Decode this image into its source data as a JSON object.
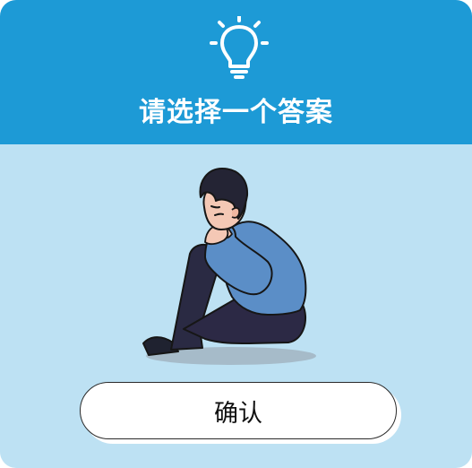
{
  "header": {
    "icon": "lightbulb-icon",
    "title": "请选择一个答案"
  },
  "illustration": {
    "name": "sad-person-sitting-illustration"
  },
  "actions": {
    "confirm_label": "确认"
  },
  "colors": {
    "header_bg": "#1d9ad6",
    "body_bg": "#bde1f3",
    "button_bg": "#ffffff"
  }
}
